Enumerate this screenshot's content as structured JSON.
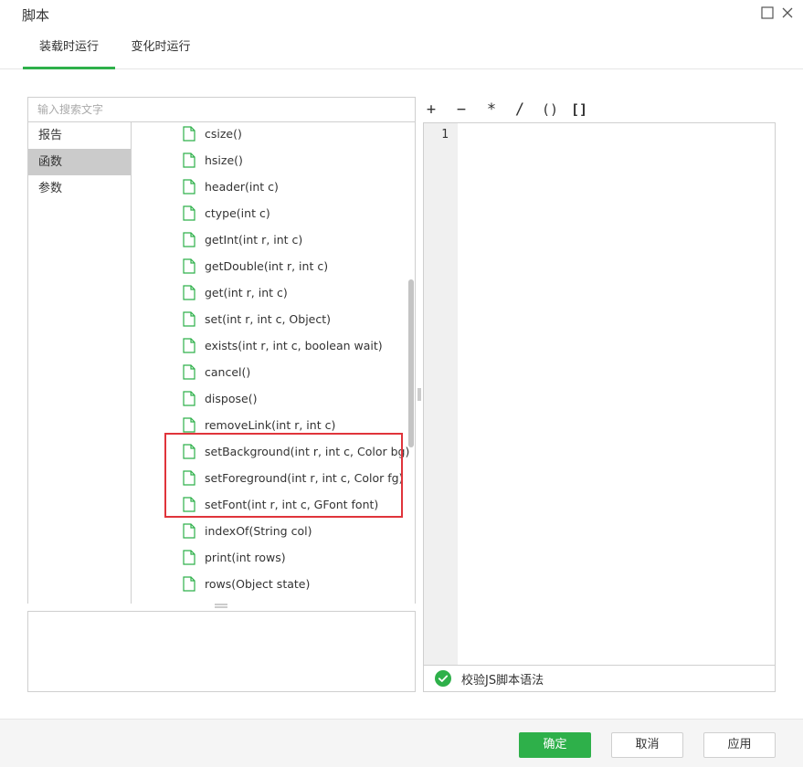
{
  "window": {
    "title": "脚本",
    "maximize_icon": "square-icon",
    "close_icon": "close-icon"
  },
  "tabs": [
    {
      "label": "装载时运行",
      "active": true
    },
    {
      "label": "变化时运行",
      "active": false
    }
  ],
  "search": {
    "placeholder": "输入搜索文字",
    "value": ""
  },
  "categories": [
    {
      "label": "报告",
      "selected": false
    },
    {
      "label": "函数",
      "selected": true
    },
    {
      "label": "参数",
      "selected": false
    }
  ],
  "functions": [
    "csize()",
    "hsize()",
    "header(int c)",
    "ctype(int c)",
    "getInt(int r, int c)",
    "getDouble(int r, int c)",
    "get(int r, int c)",
    "set(int r, int c, Object)",
    "exists(int r, int c, boolean wait)",
    "cancel()",
    "dispose()",
    "removeLink(int r, int c)",
    "setBackground(int r, int c, Color bg)",
    "setForeground(int r, int c, Color fg)",
    "setFont(int r, int c, GFont font)",
    "indexOf(String col)",
    "print(int rows)",
    "rows(Object state)"
  ],
  "operators": [
    "+",
    "−",
    "*",
    "/",
    "()",
    "[]"
  ],
  "editor": {
    "line_numbers": [
      "1"
    ]
  },
  "validate": {
    "label": "校验JS脚本语法"
  },
  "buttons": {
    "ok": "确定",
    "cancel": "取消",
    "apply": "应用"
  },
  "colors": {
    "accent": "#2eb04a",
    "highlight": "#e0343b",
    "selected_bg": "#cbcbcb"
  }
}
